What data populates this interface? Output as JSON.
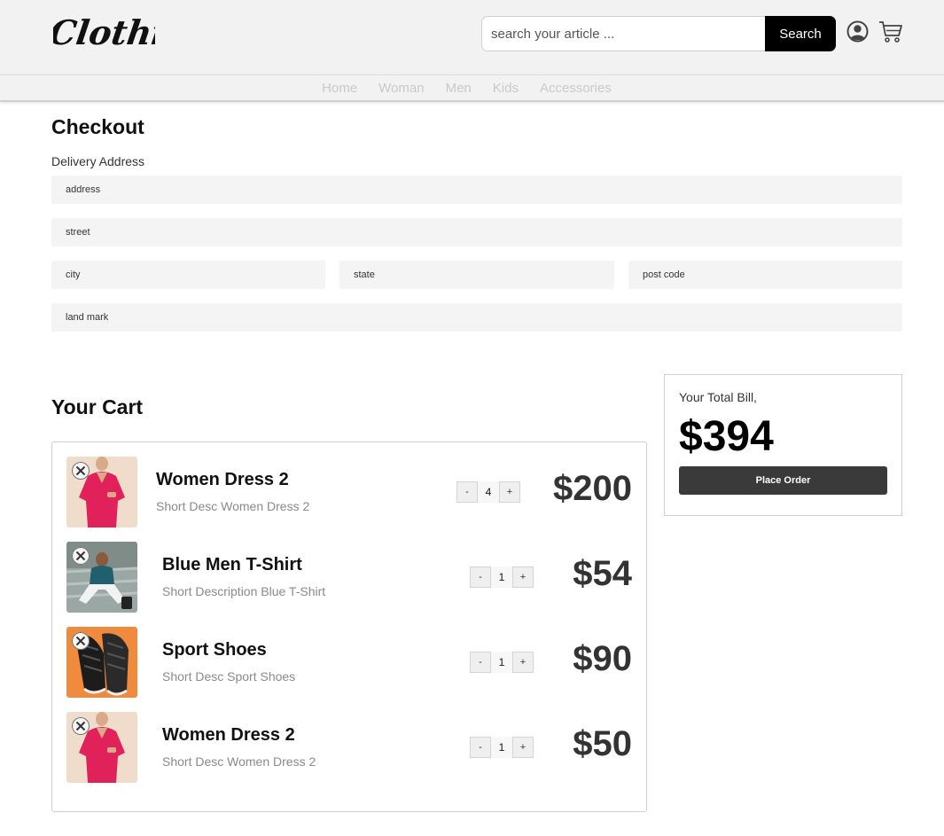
{
  "header": {
    "logo_text": "Clothing",
    "search": {
      "placeholder": "search your article ...",
      "button_label": "Search"
    }
  },
  "nav": {
    "items": [
      "Home",
      "Woman",
      "Men",
      "Kids",
      "Accessories"
    ]
  },
  "checkout": {
    "title": "Checkout",
    "delivery_label": "Delivery Address",
    "fields": {
      "address": "address",
      "street": "street",
      "city": "city",
      "state": "state",
      "post_code": "post code",
      "land_mark": "land mark"
    }
  },
  "bill": {
    "label": "Your Total Bill,",
    "total": "$394",
    "button_label": "Place Order"
  },
  "cart": {
    "title": "Your Cart",
    "items": [
      {
        "name": "Women Dress 2",
        "desc": "Short Desc Women Dress 2",
        "qty": "4",
        "price": "$200",
        "image": "pink-dress-photo"
      },
      {
        "name": "Blue Men T-Shirt",
        "desc": "Short Description Blue T-Shirt",
        "qty": "1",
        "price": "$54",
        "image": "man-tshirt-photo"
      },
      {
        "name": "Sport Shoes",
        "desc": "Short Desc Sport Shoes",
        "qty": "1",
        "price": "$90",
        "image": "sport-shoes-photo"
      },
      {
        "name": "Women Dress 2",
        "desc": "Short Desc Women Dress 2",
        "qty": "1",
        "price": "$50",
        "image": "pink-dress-photo"
      }
    ],
    "qty_minus": "-",
    "qty_plus": "+"
  },
  "icons": {
    "user": "user-icon",
    "cart": "cart-icon",
    "remove": "close-icon"
  }
}
